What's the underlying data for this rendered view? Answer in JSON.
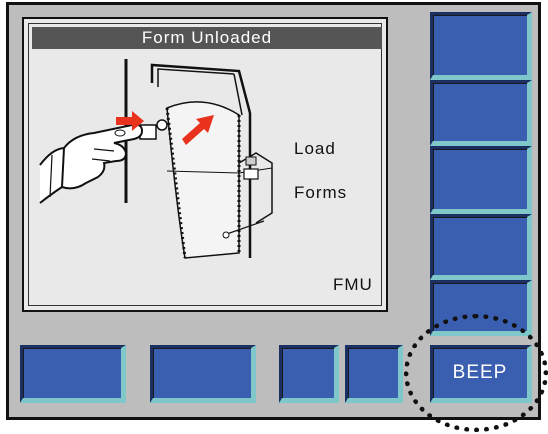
{
  "screen": {
    "title": "Form Unloaded",
    "instruction_line1": "Load",
    "instruction_line2": "Forms",
    "status_code": "FMU",
    "illustration_icon": "load-forms-illustration-icon"
  },
  "softkeys": {
    "right": [
      "",
      "",
      "",
      "",
      ""
    ],
    "bottom": [
      "",
      "",
      "",
      ""
    ],
    "beep_label": "BEEP"
  },
  "colors": {
    "key_face": "#3a5fb0",
    "key_highlight": "#7fc7c8",
    "bezel": "#bdbdbd",
    "screen": "#e9e9e9",
    "title_bar": "#555555",
    "arrow": "#e8321e"
  }
}
